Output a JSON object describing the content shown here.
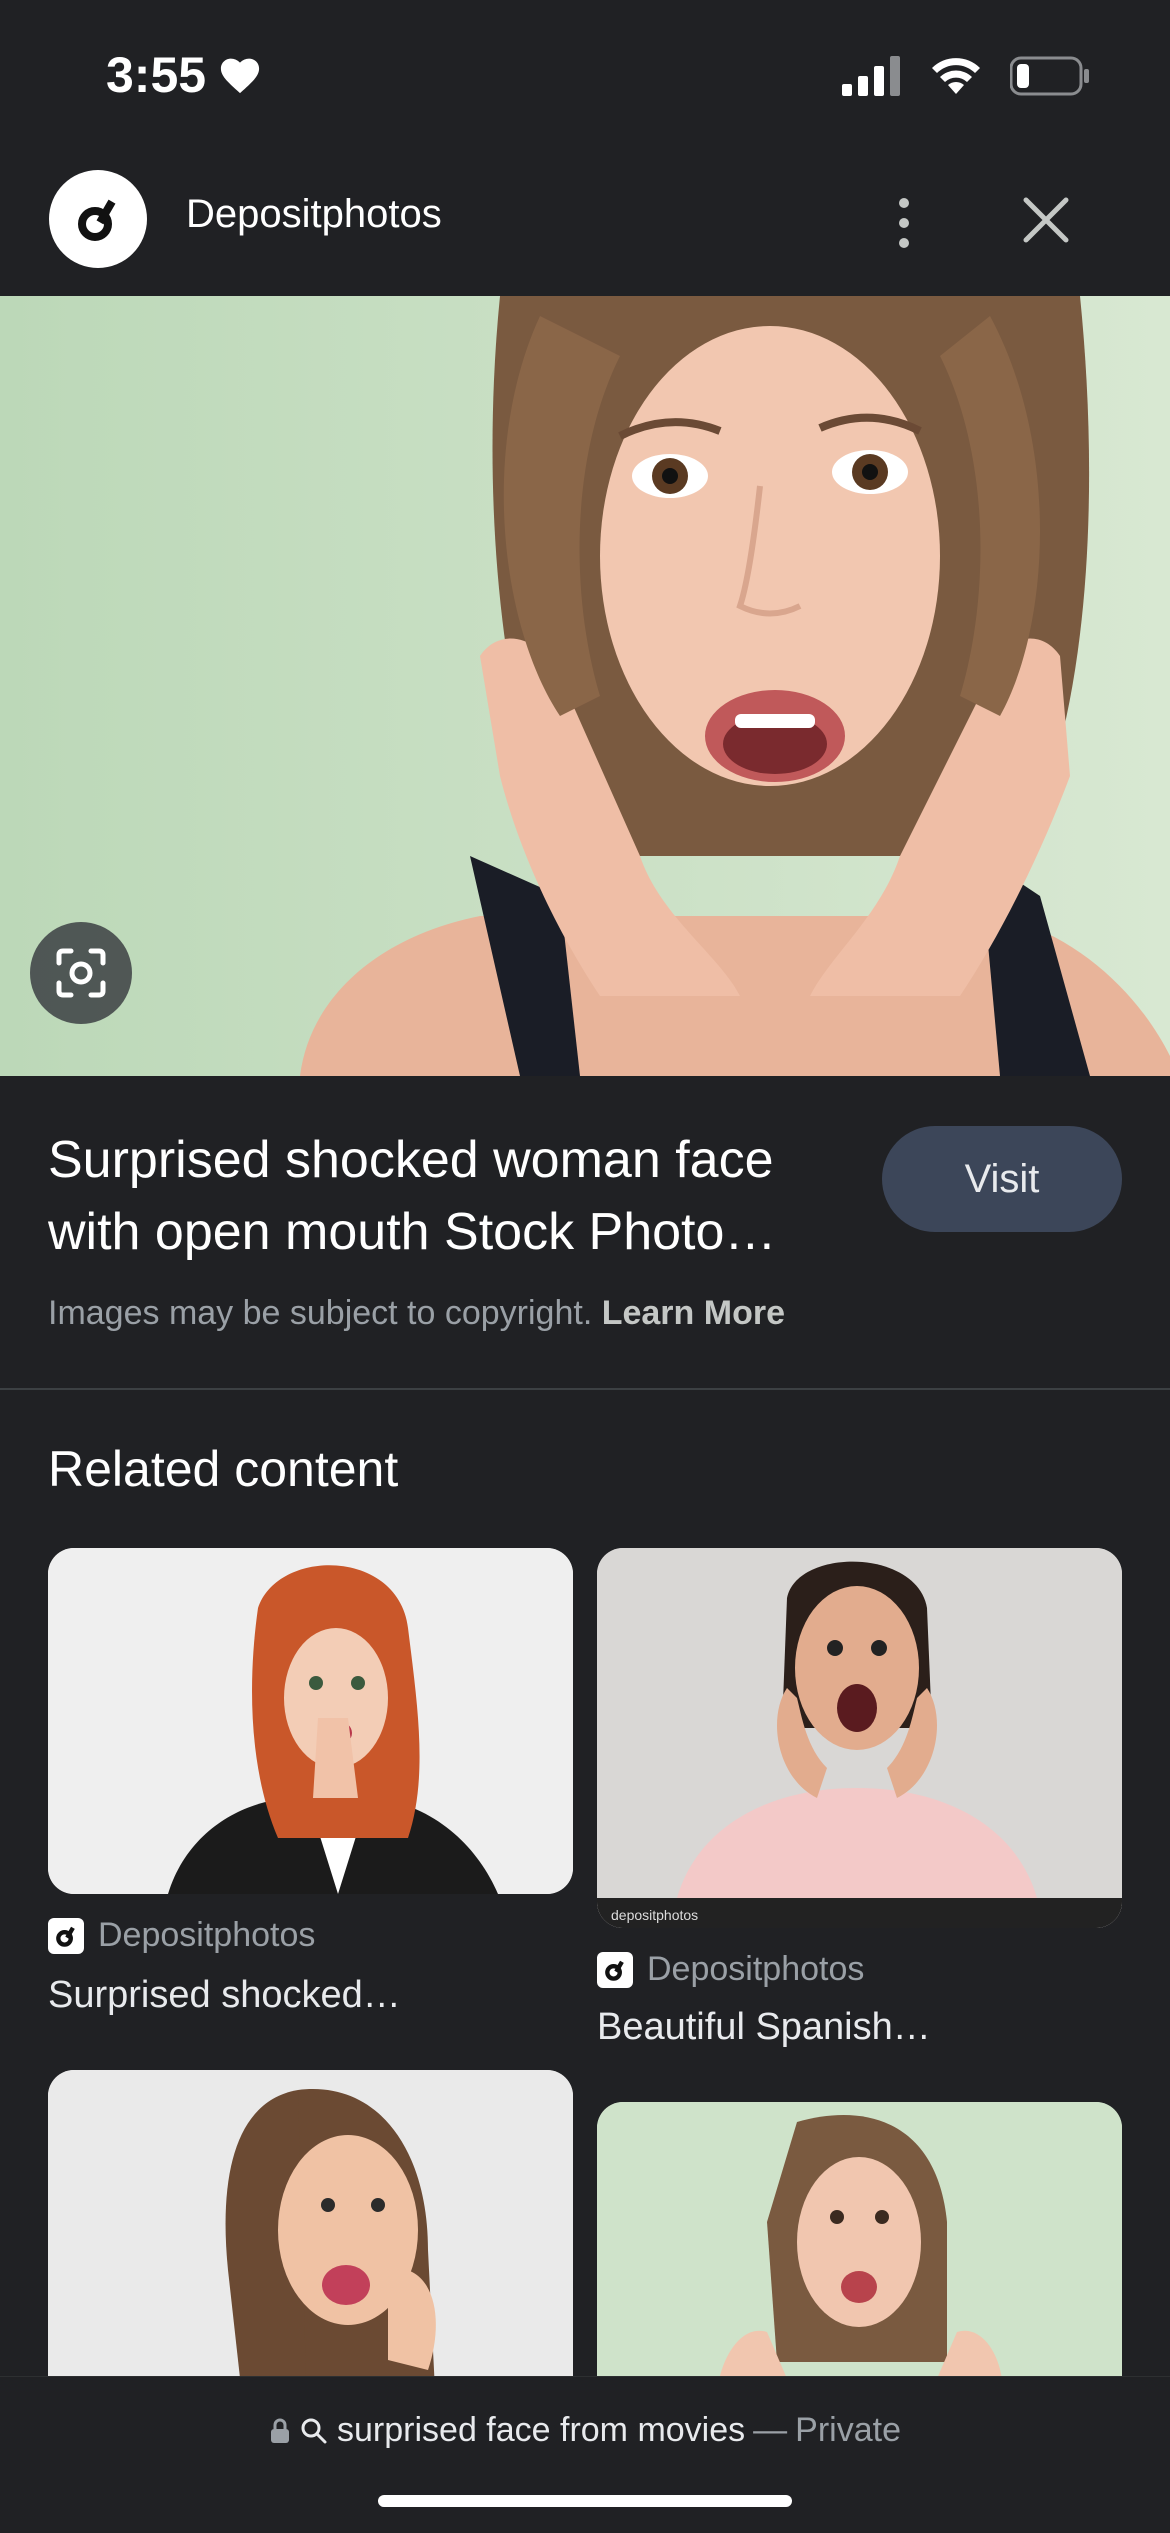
{
  "status_bar": {
    "time": "3:55",
    "battery_level": 0.2
  },
  "header": {
    "site_name": "Depositphotos"
  },
  "image": {
    "title_line1": "Surprised shocked woman face",
    "title_line2": "with open mouth Stock Photo…"
  },
  "visit_label": "Visit",
  "copyright": {
    "text": "Images may be subject to copyright.",
    "link": "Learn More"
  },
  "related": {
    "heading": "Related content",
    "items": [
      {
        "source": "Depositphotos",
        "title": "Surprised shocked…"
      },
      {
        "source": "Depositphotos",
        "title": "Beautiful Spanish…"
      }
    ]
  },
  "address_bar": {
    "query": "surprised face from movies",
    "separator": "—",
    "mode": "Private"
  },
  "colors": {
    "background": "#202124",
    "visit_button": "#3c4659",
    "muted_text": "#9aa0a6"
  }
}
